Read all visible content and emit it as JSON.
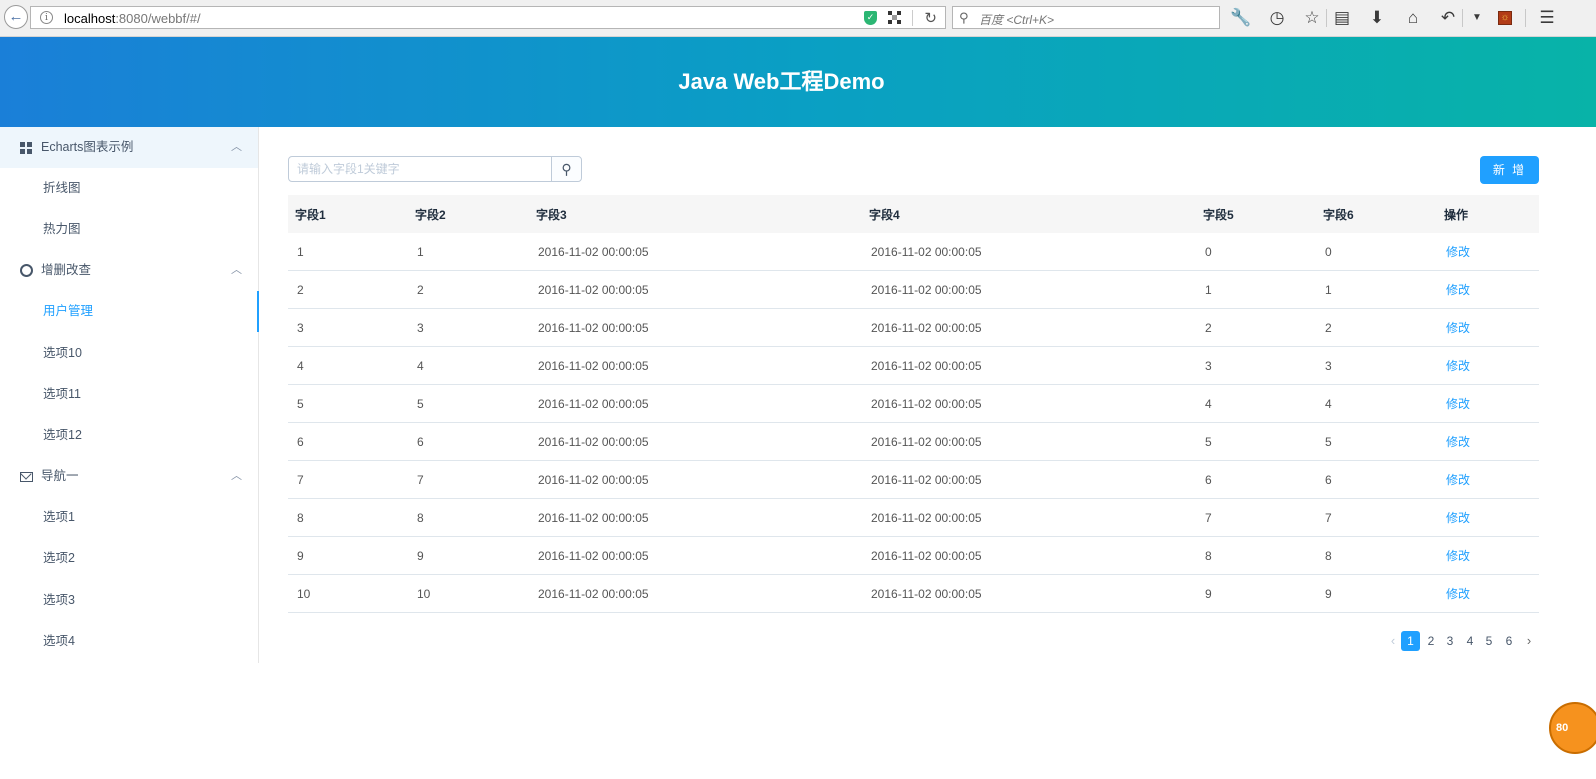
{
  "browser": {
    "url_host": "localhost",
    "url_rest": ":8080/webbf/#/",
    "search_placeholder": "百度 <Ctrl+K>"
  },
  "header": {
    "title": "Java Web工程Demo"
  },
  "sidebar": {
    "groups": [
      {
        "title": "Echarts图表示例",
        "icon": "grid-icon",
        "items": [
          "折线图",
          "热力图"
        ]
      },
      {
        "title": "增删改查",
        "icon": "gear-icon",
        "items": [
          "用户管理",
          "选项10",
          "选项11",
          "选项12"
        ]
      },
      {
        "title": "导航一",
        "icon": "mail-icon",
        "items": [
          "选项1",
          "选项2",
          "选项3",
          "选项4"
        ]
      }
    ]
  },
  "toolbar": {
    "search_placeholder": "请输入字段1关键字",
    "add_label": "新 增"
  },
  "table": {
    "columns": [
      "字段1",
      "字段2",
      "字段3",
      "字段4",
      "字段5",
      "字段6",
      "操作"
    ],
    "rows": [
      [
        "1",
        "1",
        "2016-11-02 00:00:05",
        "2016-11-02 00:00:05",
        "0",
        "0",
        "修改"
      ],
      [
        "2",
        "2",
        "2016-11-02 00:00:05",
        "2016-11-02 00:00:05",
        "1",
        "1",
        "修改"
      ],
      [
        "3",
        "3",
        "2016-11-02 00:00:05",
        "2016-11-02 00:00:05",
        "2",
        "2",
        "修改"
      ],
      [
        "4",
        "4",
        "2016-11-02 00:00:05",
        "2016-11-02 00:00:05",
        "3",
        "3",
        "修改"
      ],
      [
        "5",
        "5",
        "2016-11-02 00:00:05",
        "2016-11-02 00:00:05",
        "4",
        "4",
        "修改"
      ],
      [
        "6",
        "6",
        "2016-11-02 00:00:05",
        "2016-11-02 00:00:05",
        "5",
        "5",
        "修改"
      ],
      [
        "7",
        "7",
        "2016-11-02 00:00:05",
        "2016-11-02 00:00:05",
        "6",
        "6",
        "修改"
      ],
      [
        "8",
        "8",
        "2016-11-02 00:00:05",
        "2016-11-02 00:00:05",
        "7",
        "7",
        "修改"
      ],
      [
        "9",
        "9",
        "2016-11-02 00:00:05",
        "2016-11-02 00:00:05",
        "8",
        "8",
        "修改"
      ],
      [
        "10",
        "10",
        "2016-11-02 00:00:05",
        "2016-11-02 00:00:05",
        "9",
        "9",
        "修改"
      ]
    ]
  },
  "pagination": {
    "pages": [
      "1",
      "2",
      "3",
      "4",
      "5",
      "6"
    ],
    "current": "1"
  },
  "float_badge": "80",
  "colors": {
    "accent": "#20a0ff",
    "header_start": "#1a7fd8",
    "header_end": "#08b3a8"
  }
}
